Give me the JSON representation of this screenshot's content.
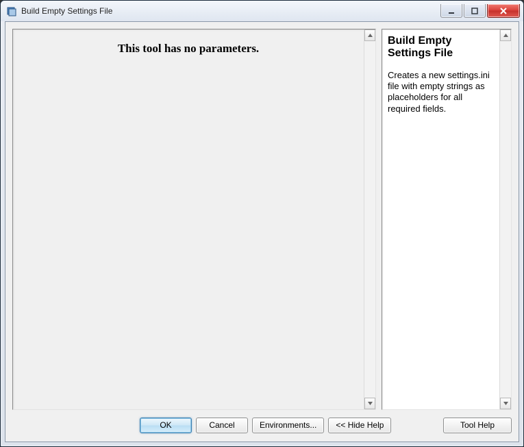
{
  "window": {
    "title": "Build Empty Settings File"
  },
  "main": {
    "message": "This tool has no parameters."
  },
  "help": {
    "title": "Build Empty Settings File",
    "description": "Creates a new settings.ini file with empty strings as placeholders for all required fields."
  },
  "buttons": {
    "ok": "OK",
    "cancel": "Cancel",
    "environments": "Environments...",
    "hide_help": "<< Hide Help",
    "tool_help": "Tool Help"
  }
}
